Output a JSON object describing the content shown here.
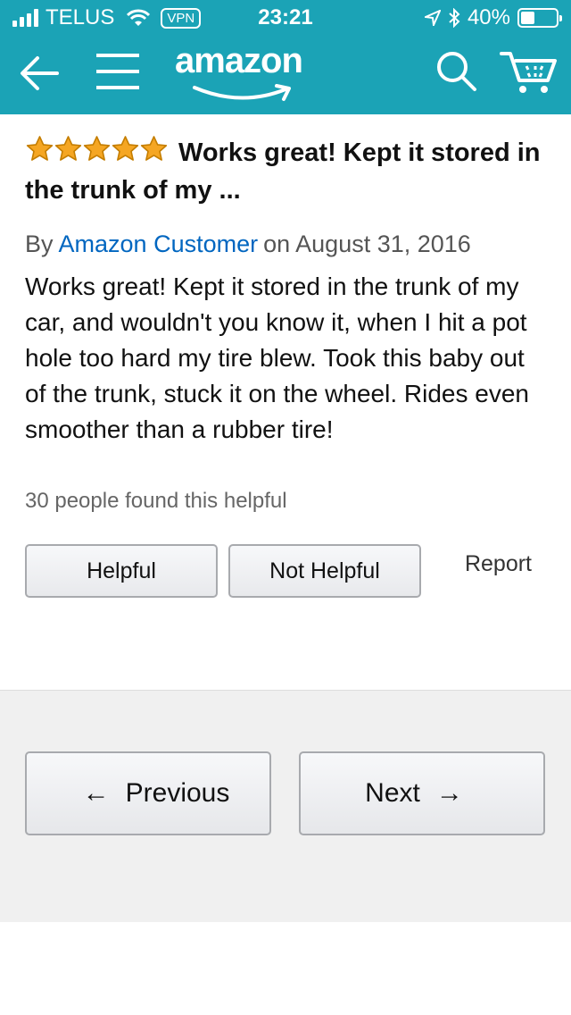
{
  "status_bar": {
    "carrier": "TELUS",
    "vpn": "VPN",
    "time": "23:21",
    "battery": "40%",
    "battery_level": 0.4
  },
  "nav": {
    "logo": "amazon"
  },
  "review": {
    "rating": 5,
    "title": "Works great! Kept it stored in the trunk of my ...",
    "by_label": "By",
    "author": "Amazon Customer",
    "date": "on August 31, 2016",
    "body": "Works great! Kept it stored in the trunk of my car, and wouldn't you know it, when I hit a pot hole too hard my tire blew. Took this baby out of the trunk, stuck it on the wheel. Rides even smoother than a rubber tire!",
    "helpful_count": "30 people found this helpful",
    "helpful_label": "Helpful",
    "not_helpful_label": "Not Helpful",
    "report_label": "Report"
  },
  "pager": {
    "previous_label": "Previous",
    "next_label": "Next",
    "left_arrow": "←",
    "right_arrow": "→"
  },
  "colors": {
    "header": "#1ba3b6",
    "star": "#f5a623",
    "link": "#0066c0"
  }
}
